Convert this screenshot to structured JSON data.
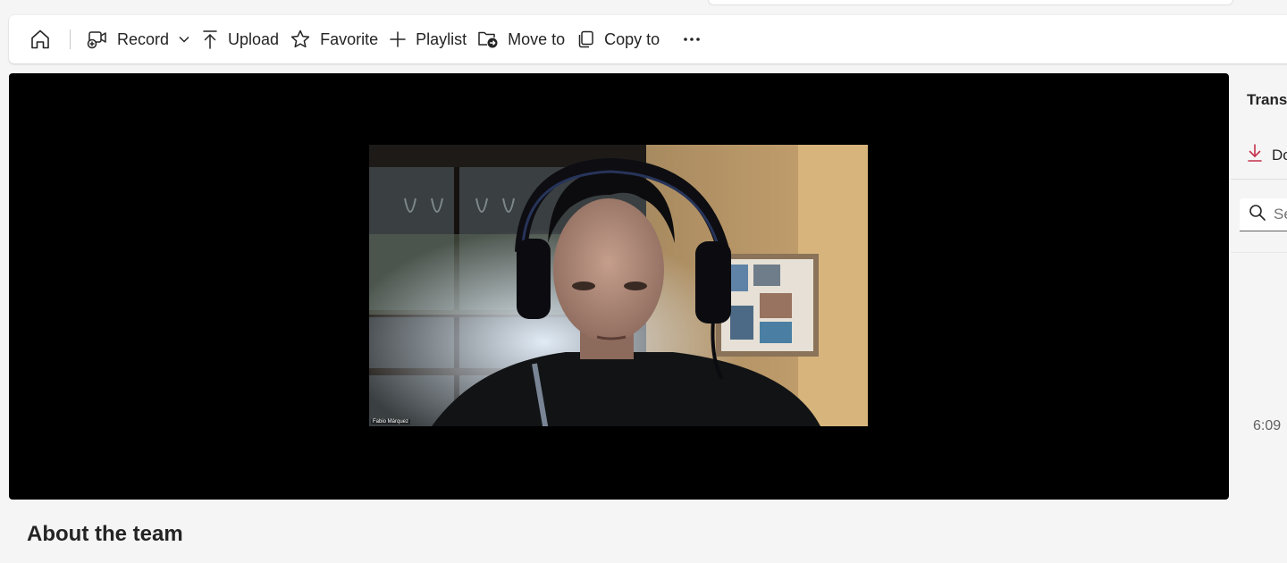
{
  "toolbar": {
    "home_icon": "home-icon",
    "record": {
      "label": "Record",
      "icon": "video-add-icon"
    },
    "upload": {
      "label": "Upload",
      "icon": "arrow-upload-icon"
    },
    "favorite": {
      "label": "Favorite",
      "icon": "star-icon"
    },
    "playlist": {
      "label": "Playlist",
      "icon": "plus-icon"
    },
    "move_to": {
      "label": "Move to",
      "icon": "folder-move-icon"
    },
    "copy_to": {
      "label": "Copy to",
      "icon": "copy-icon"
    },
    "more_icon": "more-horizontal-icon"
  },
  "player": {
    "participant_name": "Fabio Márquez"
  },
  "side_panel": {
    "title": "Transcript",
    "download_label": "Download",
    "download_color": "#c4314b",
    "search_placeholder": "Search",
    "timestamp": "6:09"
  },
  "main": {
    "section_title": "About the team"
  }
}
